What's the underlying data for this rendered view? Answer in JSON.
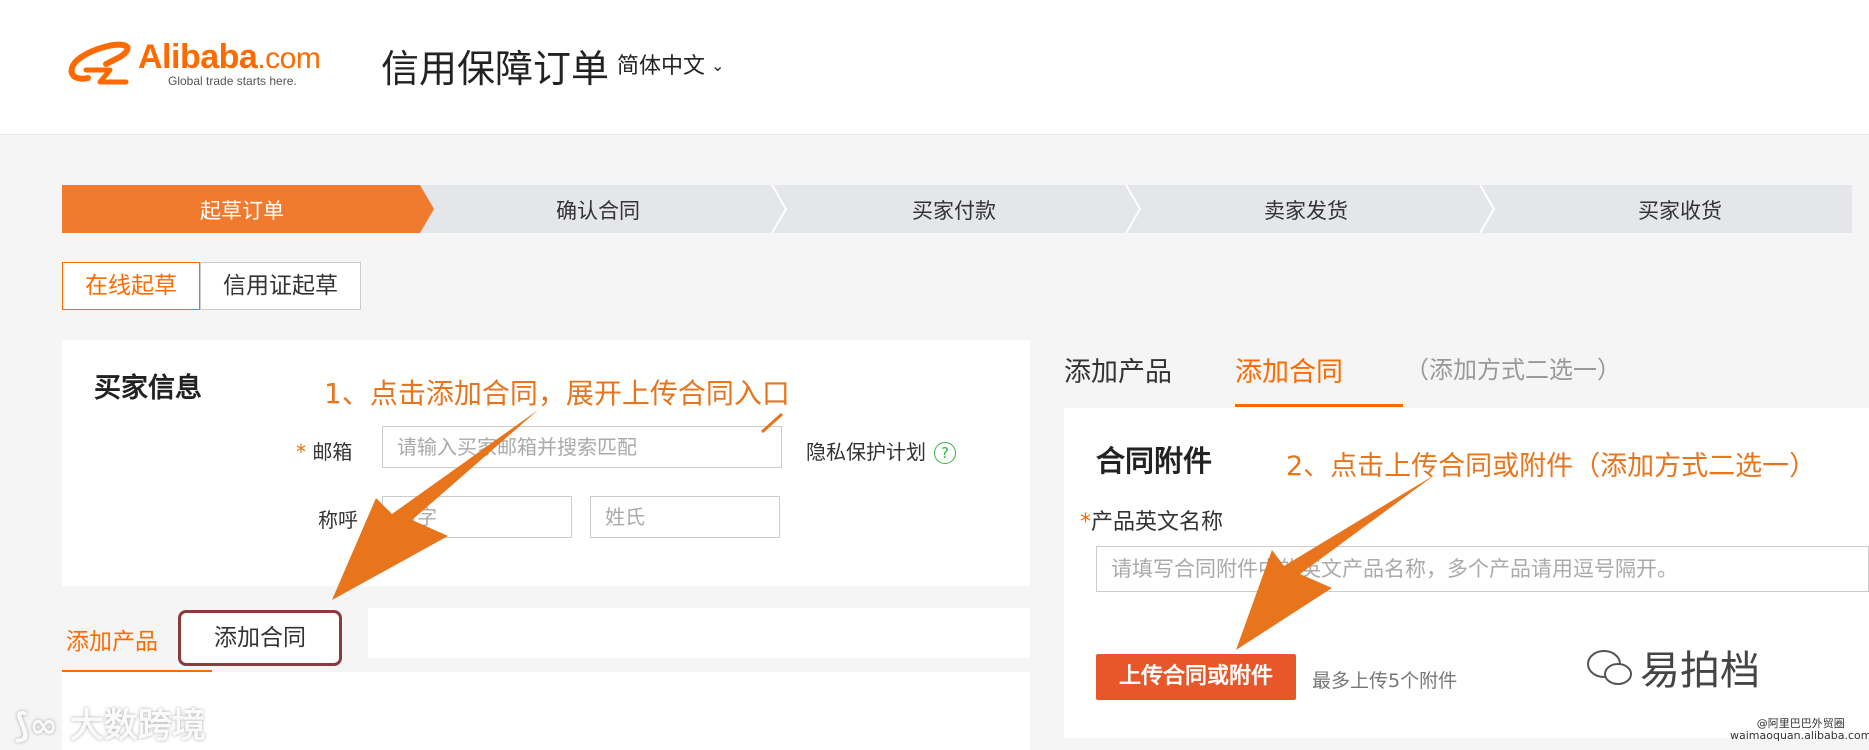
{
  "header": {
    "logo_word": "Alibaba",
    "logo_com": ".com",
    "logo_tagline": "Global trade starts here.",
    "title": "信用保障订单",
    "language": "简体中文"
  },
  "steps": [
    "起草订单",
    "确认合同",
    "买家付款",
    "卖家发货",
    "买家收货"
  ],
  "draft_tabs": [
    "在线起草",
    "信用证起草"
  ],
  "buyer": {
    "title": "买家信息",
    "email_label": "邮箱",
    "email_placeholder": "请输入买家邮箱并搜索匹配",
    "name_label": "称呼",
    "first_name_placeholder": "名字",
    "last_name_placeholder": "姓氏",
    "privacy": "隐私保护计划",
    "help_glyph": "?"
  },
  "left_tabs": {
    "product": "添加产品",
    "contract": "添加合同"
  },
  "right": {
    "tab_product": "添加产品",
    "tab_contract": "添加合同",
    "tab_hint": "（添加方式二选一）",
    "panel_title": "合同附件",
    "field_label": "产品英文名称",
    "field_placeholder": "请填写合同附件中的英文产品名称，多个产品请用逗号隔开。",
    "upload_button": "上传合同或附件",
    "upload_note": "最多上传5个附件"
  },
  "annotations": {
    "step1": "1、点击添加合同，展开上传合同入口",
    "step2": "2、点击上传合同或附件（添加方式二选一）"
  },
  "watermarks": {
    "left": "大数跨境",
    "right": "易拍档",
    "site_line1": "@阿里巴巴外贸圈",
    "site_line2": "waimaoquan.alibaba.com"
  },
  "colors": {
    "accent": "#ff6a00",
    "step_active": "#f07b2f",
    "upload_button": "#e8572a",
    "arrow": "#e8741c",
    "highlight_box": "#8a3b3b"
  }
}
